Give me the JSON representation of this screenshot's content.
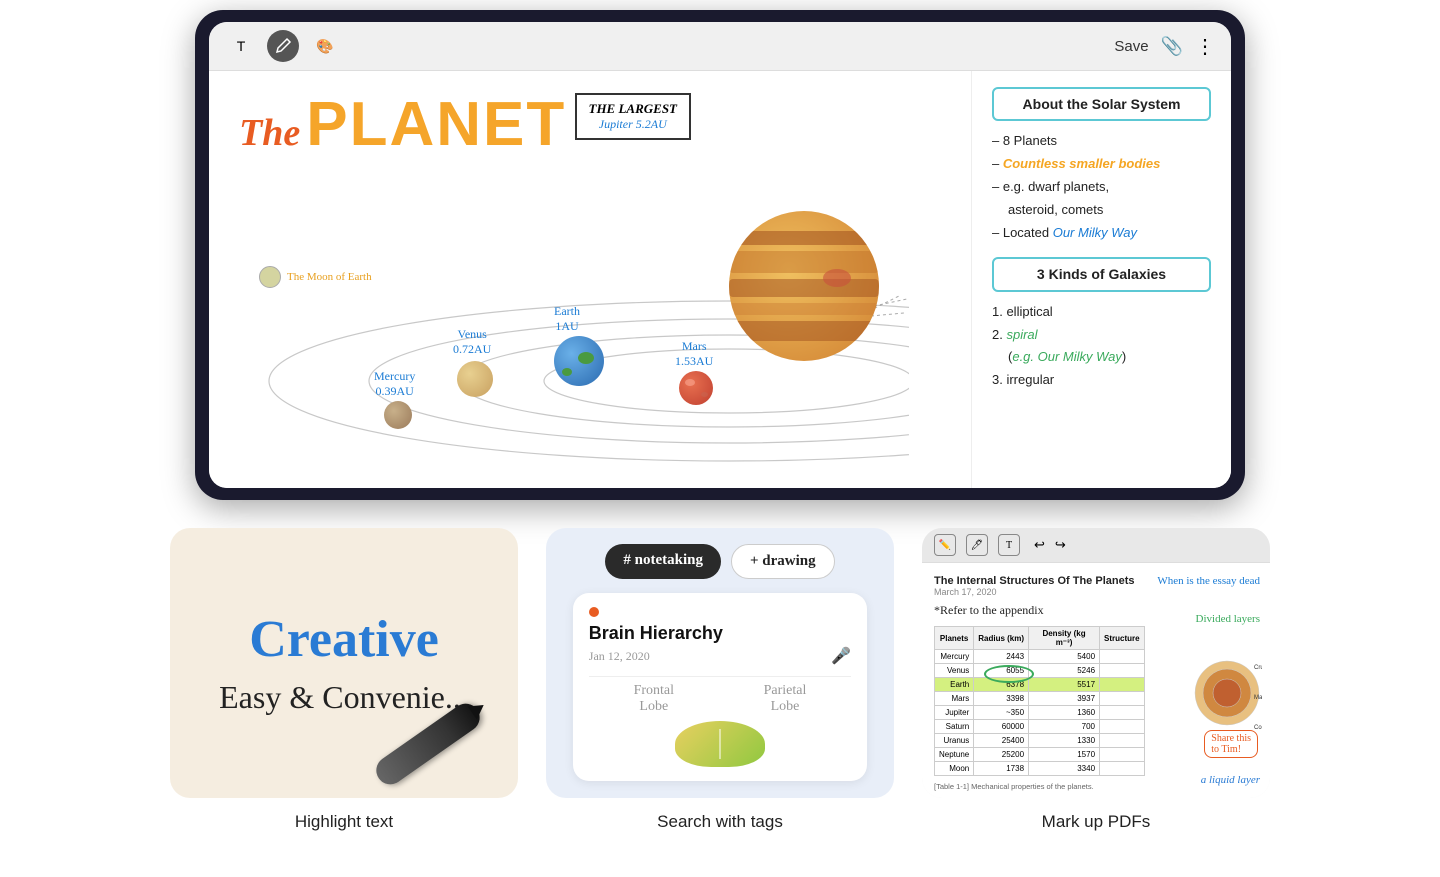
{
  "toolbar": {
    "tools": [
      "T",
      "✒",
      "🎨"
    ],
    "active_tool": 1,
    "save_label": "Save",
    "attach_icon": "📎",
    "more_icon": "⋮"
  },
  "planet_drawing": {
    "title_the": "The",
    "title_planet": "PLANET",
    "largest_title": "THE LARGEST",
    "largest_sub": "Jupiter 5.2AU",
    "moon_label": "The Moon of Earth",
    "planets": [
      {
        "name": "Mercury",
        "au": "0.39AU"
      },
      {
        "name": "Venus",
        "au": "0.72AU"
      },
      {
        "name": "Earth",
        "au": "1AU"
      },
      {
        "name": "Mars",
        "au": "1.53AU"
      }
    ]
  },
  "notes": {
    "solar_box": "About the Solar System",
    "solar_points": [
      "– 8 Planets",
      "– Countless smaller bodies",
      "– e.g. dwarf planets,",
      "     asteroid, comets",
      "– Located Our Milky Way"
    ],
    "galaxies_box": "3 Kinds of Galaxies",
    "galaxy_points": [
      "1. elliptical",
      "2. spiral",
      "   (e.g. Our Milky Way)",
      "3. irregular"
    ]
  },
  "features": [
    {
      "title": "Highlight text",
      "card_text1": "Creative",
      "card_text2": "Easy & Convenie..."
    },
    {
      "title": "Search with tags",
      "tag1": "# notetaking",
      "tag2": "+ drawing",
      "note_title": "Brain Hierarchy",
      "note_date": "Jan 12, 2020",
      "note_lobe1": "Frontal\nLobe",
      "note_lobe2": "Parietal\nLobe"
    },
    {
      "title": "Mark up PDFs",
      "pdf_main_title": "The Internal Structures Of The Planets",
      "pdf_date": "March 17, 2020",
      "pdf_when": "When is the essay dead",
      "pdf_refer": "*Refer to the appendix",
      "pdf_divided": "Divided layers",
      "pdf_share": "Share this\nto Tim!",
      "pdf_liquid": "a liquid layer",
      "table_headers": [
        "Planets",
        "Radius (km)",
        "Density (kg m⁻³)",
        "Structure"
      ],
      "table_rows": [
        [
          "Mercury",
          "2443",
          "5400"
        ],
        [
          "Venus",
          "6055",
          "5246"
        ],
        [
          "Earth",
          "6378",
          "5517"
        ],
        [
          "Mars",
          "3398",
          "3937"
        ],
        [
          "Jupiter",
          "~350",
          "1360"
        ],
        [
          "Saturn",
          "60000",
          "700"
        ],
        [
          "Uranus",
          "25400",
          "1330"
        ],
        [
          "Neptune",
          "25200",
          "1570"
        ],
        [
          "Moon",
          "1738",
          "3340"
        ]
      ],
      "table_note": "[Table 1-1] Mechanical properties of the planets."
    }
  ]
}
